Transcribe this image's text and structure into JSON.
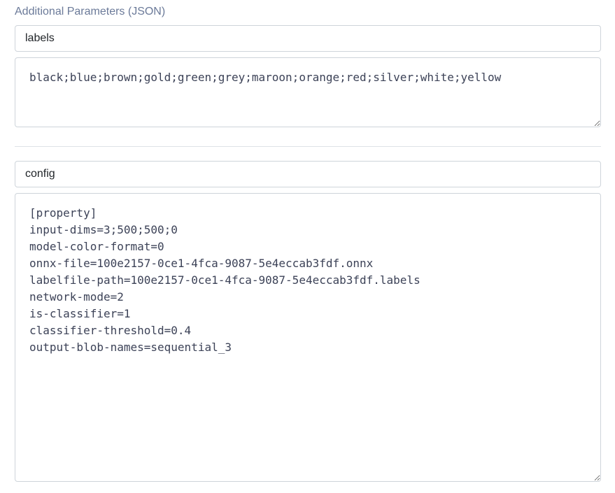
{
  "section": {
    "title": "Additional Parameters (JSON)"
  },
  "params": [
    {
      "key": "labels",
      "value": "black;blue;brown;gold;green;grey;maroon;orange;red;silver;white;yellow"
    },
    {
      "key": "config",
      "value": "[property]\ninput-dims=3;500;500;0\nmodel-color-format=0\nonnx-file=100e2157-0ce1-4fca-9087-5e4eccab3fdf.onnx\nlabelfile-path=100e2157-0ce1-4fca-9087-5e4eccab3fdf.labels\nnetwork-mode=2\nis-classifier=1\nclassifier-threshold=0.4\noutput-blob-names=sequential_3"
    }
  ]
}
